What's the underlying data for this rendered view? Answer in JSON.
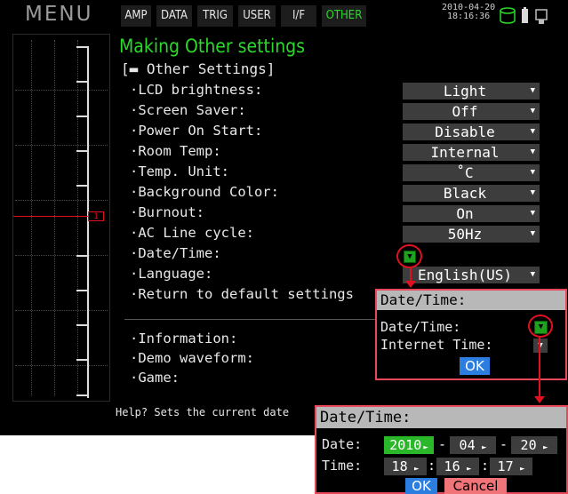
{
  "header": {
    "menu_label": "MENU",
    "tabs": [
      {
        "label": "AMP"
      },
      {
        "label": "DATA"
      },
      {
        "label": "TRIG"
      },
      {
        "label": "USER"
      },
      {
        "label": "I/F"
      },
      {
        "label": "OTHER",
        "active": true
      }
    ],
    "date": "2010-04-20",
    "time": "18:16:36",
    "status_icons": [
      "storage-icon",
      "battery-icon",
      "usb-icon"
    ]
  },
  "graph": {
    "channel_marker": "1"
  },
  "panel": {
    "title": "Making Other settings",
    "section": "[▬ Other Settings]",
    "rows": [
      {
        "label": "·LCD brightness:",
        "value": "Light"
      },
      {
        "label": "·Screen Saver:",
        "value": "Off"
      },
      {
        "label": "·Power On Start:",
        "value": "Disable"
      },
      {
        "label": "·Room Temp:",
        "value": "Internal"
      },
      {
        "label": "·Temp. Unit:",
        "value": "˚C"
      },
      {
        "label": "·Background Color:",
        "value": "Black"
      },
      {
        "label": "·Burnout:",
        "value": "On"
      },
      {
        "label": "·AC Line cycle:",
        "value": "50Hz"
      },
      {
        "label": "·Date/Time:",
        "value": ""
      },
      {
        "label": "·Language:",
        "value": "English(US)"
      },
      {
        "label": "·Return to default settings",
        "value": ""
      }
    ],
    "more_rows": [
      {
        "label": "·Information:"
      },
      {
        "label": "·Demo waveform:"
      },
      {
        "label": "·Game:"
      }
    ],
    "help": "Help? Sets the current date"
  },
  "popup_datetime": {
    "title": "Date/Time:",
    "rows": [
      {
        "label": "Date/Time:"
      },
      {
        "label": "Internet Time:"
      }
    ],
    "ok": "OK"
  },
  "popup_set": {
    "title": "Date/Time:",
    "date_label": "Date:",
    "time_label": "Time:",
    "year": "2010",
    "month": "04",
    "day": "20",
    "hour": "18",
    "minute": "16",
    "second": "17",
    "date_sep": "-",
    "time_sep": ":",
    "ok": "OK",
    "cancel": "Cancel"
  },
  "colors": {
    "accent_green": "#2bd82b",
    "highlight_red": "#e01020",
    "ok_blue": "#2c7de0",
    "cancel_pink": "#f07478"
  }
}
